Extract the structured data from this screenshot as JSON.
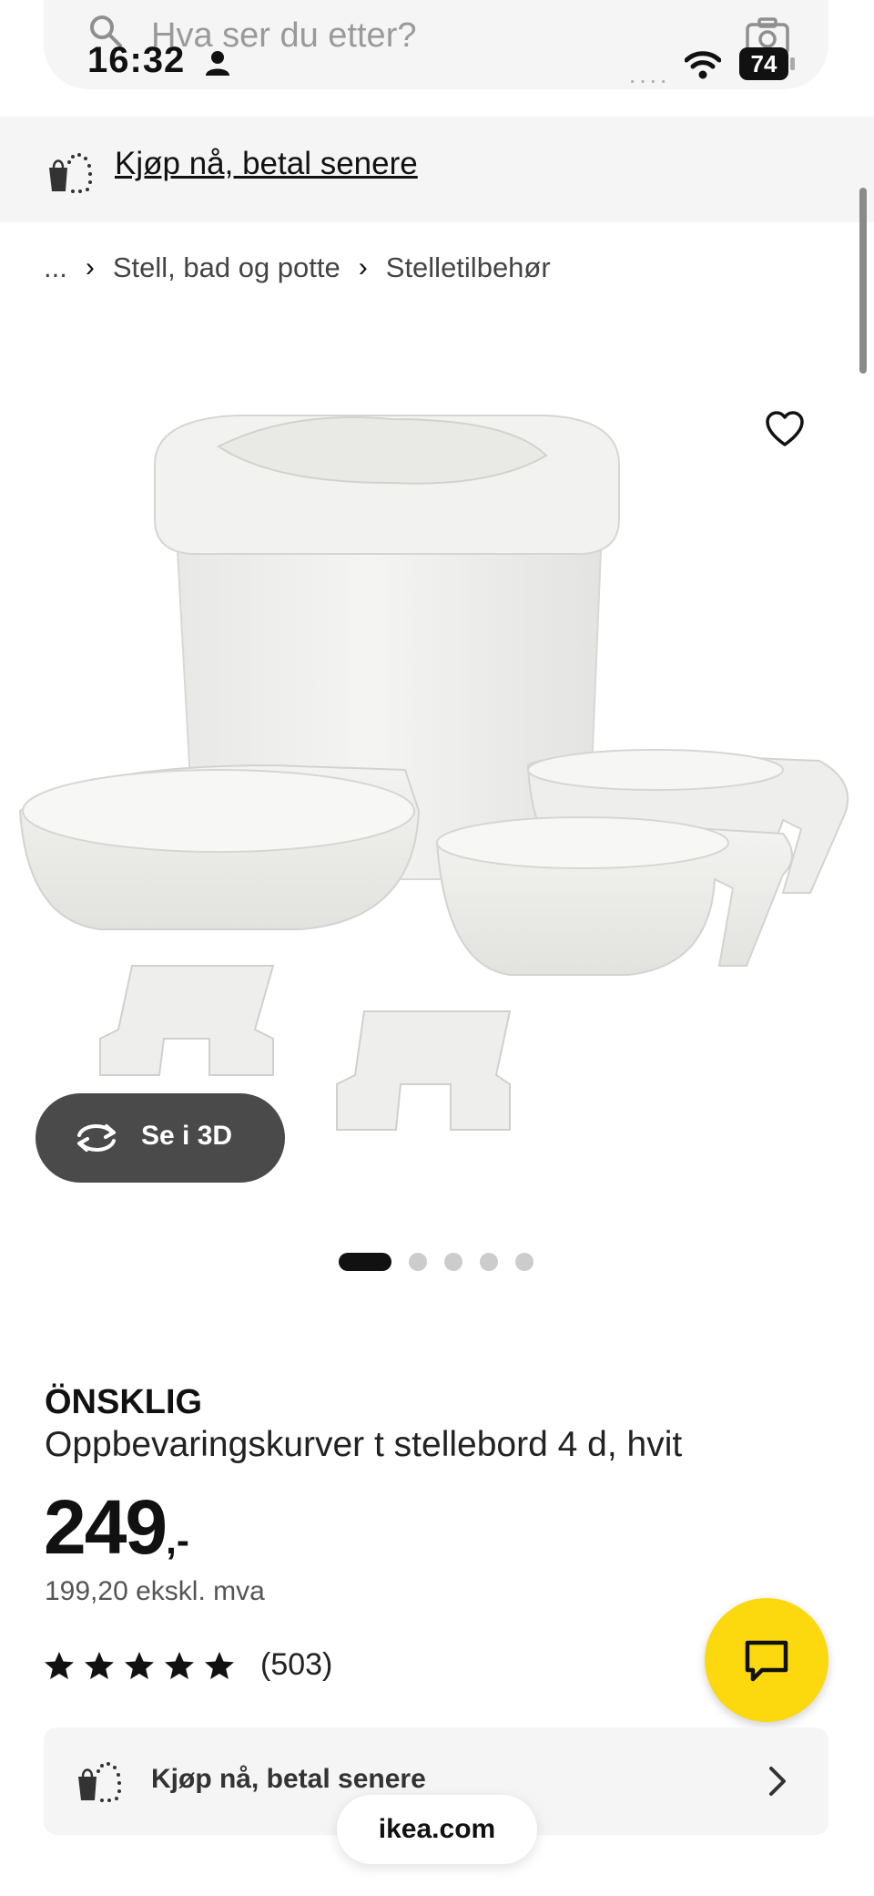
{
  "status_bar": {
    "time": "16:32",
    "battery": "74",
    "more_dots": "····"
  },
  "search": {
    "placeholder": "Hva ser du etter?"
  },
  "promo": {
    "label": "Kjøp nå, betal senere"
  },
  "breadcrumb": {
    "ellipsis": "...",
    "items": [
      "Stell, bad og potte",
      "Stelletilbehør"
    ]
  },
  "gallery": {
    "see_3d_label": "Se i 3D",
    "total_images": 5,
    "active_index": 0
  },
  "product": {
    "brand": "ÖNSKLIG",
    "description": "Oppbevaringskurver t stellebord 4 d, hvit",
    "price": "249",
    "price_suffix": ",-",
    "price_ex_vat": "199,20 ekskl. mva",
    "rating_stars": 5,
    "review_count": "(503)"
  },
  "buy_now": {
    "label": "Kjøp nå, betal senere"
  },
  "browser": {
    "url": "ikea.com"
  },
  "colors": {
    "accent_yellow": "#fcd80f",
    "badge_dark": "#4a4a4a",
    "panel_gray": "#f5f5f5"
  }
}
